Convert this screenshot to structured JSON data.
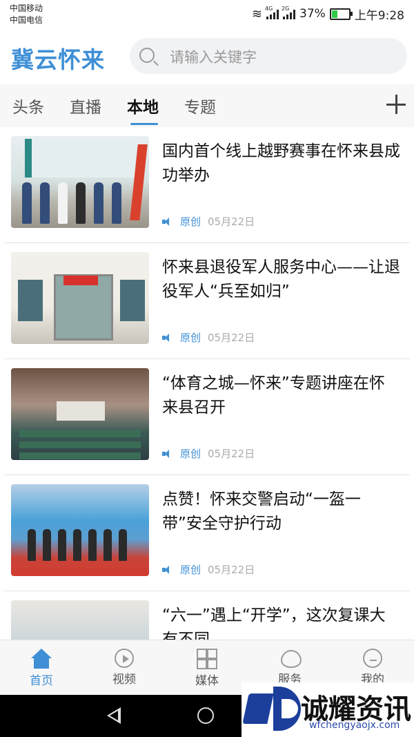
{
  "status_bar": {
    "carrier1": "中国移动",
    "carrier2": "中国电信",
    "signal1_tag": "4G",
    "signal2_tag": "2G",
    "battery": "37%",
    "battery_level": 0.37,
    "time": "上午9:28"
  },
  "header": {
    "logo": "冀云怀来",
    "search_placeholder": "请输入关键字"
  },
  "tabs": [
    {
      "label": "头条"
    },
    {
      "label": "直播"
    },
    {
      "label": "本地",
      "active": true
    },
    {
      "label": "专题"
    }
  ],
  "news": [
    {
      "title": "国内首个线上越野赛事在怀来县成功举办",
      "source": "原创",
      "date": "05月22日"
    },
    {
      "title": "怀来县退役军人服务中心——让退役军人“兵至如归”",
      "source": "原创",
      "date": "05月22日"
    },
    {
      "title": "“体育之城—怀来”专题讲座在怀来县召开",
      "source": "原创",
      "date": "05月22日"
    },
    {
      "title": "点赞！怀来交警启动“一盔一带”安全守护行动",
      "source": "原创",
      "date": "05月22日"
    },
    {
      "title": "“六一”遇上“开学”，这次复课大有不同",
      "source": "",
      "date": ""
    }
  ],
  "bottom_nav": [
    {
      "label": "首页",
      "icon": "home-icon",
      "active": true
    },
    {
      "label": "视频",
      "icon": "video-icon"
    },
    {
      "label": "媒体",
      "icon": "media-icon"
    },
    {
      "label": "服务",
      "icon": "service-icon"
    },
    {
      "label": "我的",
      "icon": "mine-icon"
    }
  ],
  "watermark": {
    "text": "诚耀资讯",
    "url": "wfchengyaojx.com"
  },
  "colors": {
    "accent": "#3e8fd6",
    "battery_fill": "#35c94a",
    "watermark_blue": "#1c3f9c"
  }
}
